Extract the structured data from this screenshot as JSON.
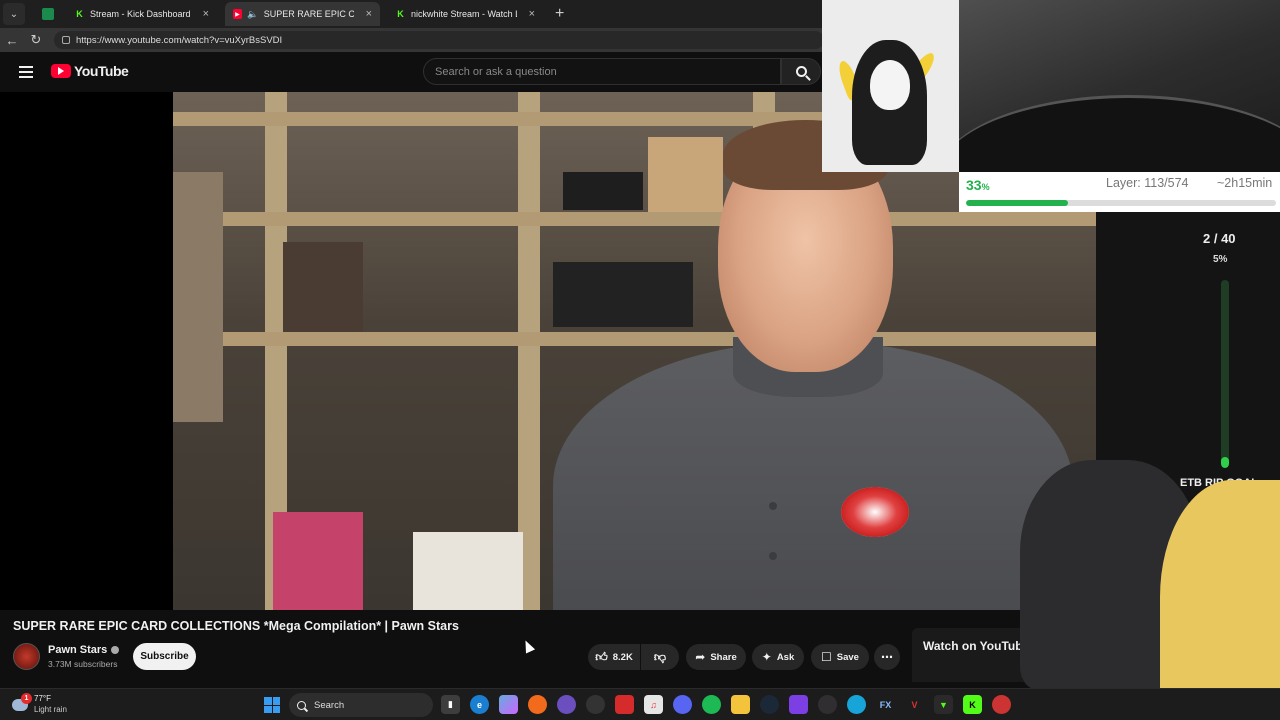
{
  "browser": {
    "tabs": [
      {
        "title": "Stream - Kick Dashboard",
        "active": false,
        "favicon": "kick-icon"
      },
      {
        "title": "SUPER RARE EPIC CARD COLLECTIONS *Mega Compilation* | Pawn Stars",
        "active": true,
        "favicon": "youtube-icon"
      },
      {
        "title": "nickwhite Stream - Watch Live on Kick",
        "active": false,
        "favicon": "kick-icon"
      }
    ],
    "url": "https://www.youtube.com/watch?v=vuXyrBsSVDI"
  },
  "header": {
    "logo_text": "YouTube",
    "search_placeholder": "Search or ask a question"
  },
  "video": {
    "title": "SUPER RARE EPIC CARD COLLECTIONS *Mega Compilation* | Pawn Stars",
    "channel_name": "Pawn Stars",
    "subscribers": "3.73M subscribers",
    "subscribe_label": "Subscribe",
    "like_count": "8.2K",
    "share_label": "Share",
    "ask_label": "Ask",
    "save_label": "Save",
    "more_icon": "more-horizontal-icon"
  },
  "watch_on_youtube": "Watch on YouTube",
  "print_overlay": {
    "percent": "33",
    "percent_unit": "%",
    "layer_text": "Layer: 113/574",
    "time_left": "~2h15min",
    "progress_fraction": 0.33,
    "accent_color": "#22b14c"
  },
  "goal_overlay": {
    "count": "2 / 40",
    "percent": "5%",
    "label": "ETB RIP GOAL",
    "progress_fraction": 0.05,
    "bar_color": "#2fd14a"
  },
  "taskbar": {
    "weather_temp": "77°F",
    "weather_desc": "Light rain",
    "weather_badge": "1",
    "search_label": "Search",
    "apps": [
      "file-explorer-icon",
      "edge-icon",
      "copilot-icon",
      "firefox-icon",
      "app-icon",
      "chrome-icon",
      "app-red-icon",
      "itunes-icon",
      "discord-icon",
      "spotify-icon",
      "folder-icon",
      "steam-icon",
      "app-purple-icon",
      "obs-icon",
      "app-blue-icon",
      "fx-icon",
      "app-v-icon",
      "app-green-icon",
      "kick-icon",
      "app-red2-icon"
    ]
  }
}
